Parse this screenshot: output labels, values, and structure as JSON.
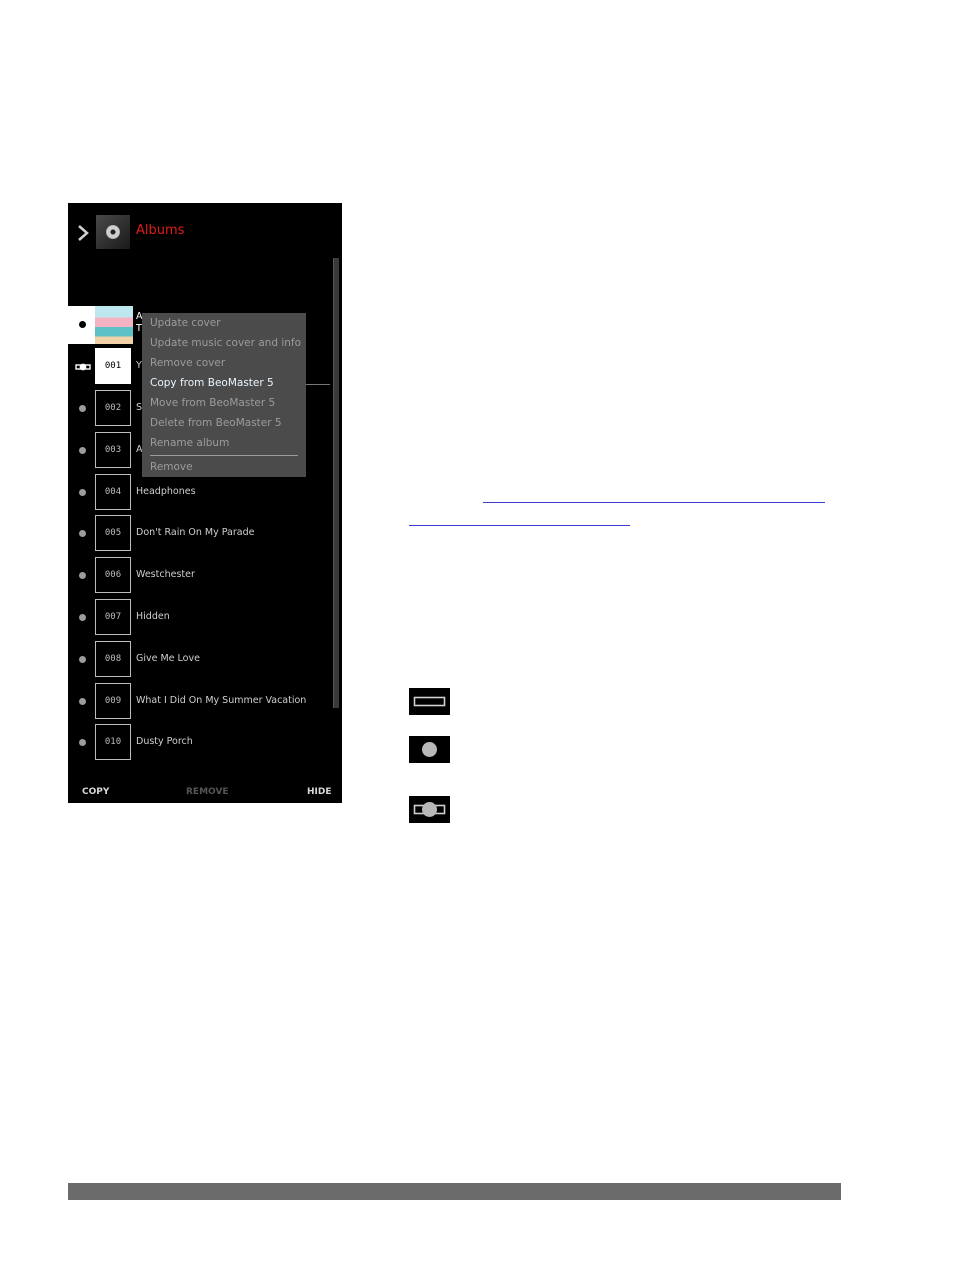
{
  "header": {
    "title": "Albums",
    "icon": "disc-icon",
    "back_icon": "chevron-right-icon"
  },
  "album": {
    "label_1": "A",
    "label_2": "T"
  },
  "tracks": [
    {
      "number": "001",
      "name": "Y"
    },
    {
      "number": "002",
      "name": "S"
    },
    {
      "number": "003",
      "name": "A"
    },
    {
      "number": "004",
      "name": "Headphones"
    },
    {
      "number": "005",
      "name": "Don't Rain On My Parade"
    },
    {
      "number": "006",
      "name": "Westchester"
    },
    {
      "number": "007",
      "name": "Hidden"
    },
    {
      "number": "008",
      "name": "Give Me Love"
    },
    {
      "number": "009",
      "name": "What I Did On My Summer Vacation"
    },
    {
      "number": "010",
      "name": "Dusty Porch"
    }
  ],
  "context_menu": {
    "items": [
      "Update cover",
      "Update music cover and info",
      "Remove cover",
      "Copy from BeoMaster 5",
      "Move from BeoMaster 5",
      "Delete from BeoMaster 5",
      "Rename album",
      "Remove"
    ],
    "active_index": 3
  },
  "actions": {
    "copy": "COPY",
    "remove": "REMOVE",
    "hide": "HIDE"
  },
  "colors": {
    "title_red": "#e11c1c",
    "panel_bg": "#000000",
    "menu_bg": "#4b4b4b",
    "link_blue": "#3a3acc"
  },
  "legend_icons": [
    "empty-rectangle-icon",
    "filled-circle-icon",
    "circle-on-bar-icon"
  ]
}
